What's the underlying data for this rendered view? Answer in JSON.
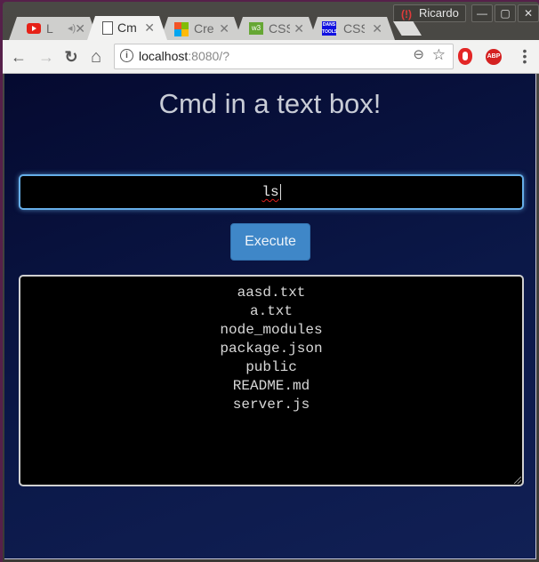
{
  "window": {
    "profile_name": "Ricardo",
    "controls": {
      "minimize": "—",
      "maximize": "▢",
      "close": "✕"
    }
  },
  "tabs": [
    {
      "title": "L",
      "icon": "youtube-icon",
      "audio": true,
      "active": false
    },
    {
      "title": "Cm",
      "icon": "page-icon",
      "audio": false,
      "active": true
    },
    {
      "title": "Cre",
      "icon": "microsoft-icon",
      "audio": false,
      "active": false
    },
    {
      "title": "CSS",
      "icon": "w3c-icon",
      "audio": false,
      "active": false
    },
    {
      "title": "CSS",
      "icon": "danstools-icon",
      "audio": false,
      "active": false
    }
  ],
  "tab_close": "✕",
  "toolbar": {
    "back": "←",
    "forward": "→",
    "reload": "↻",
    "home": "⌂",
    "url_host": "localhost",
    "url_rest": ":8080/?",
    "info": "i",
    "zoom": "⊖",
    "bookmark": "☆",
    "abp_label": "ABP",
    "menu": "⋮"
  },
  "page": {
    "title": "Cmd in a text box!",
    "command_value": "ls",
    "execute_label": "Execute",
    "output_lines": [
      "aasd.txt",
      "a.txt",
      "node_modules",
      "package.json",
      "public",
      "README.md",
      "server.js"
    ]
  },
  "colors": {
    "input_border": "#66aee8",
    "button_bg": "#3f87c8",
    "page_bg_dark": "#050a30",
    "page_bg_light": "#112055"
  }
}
